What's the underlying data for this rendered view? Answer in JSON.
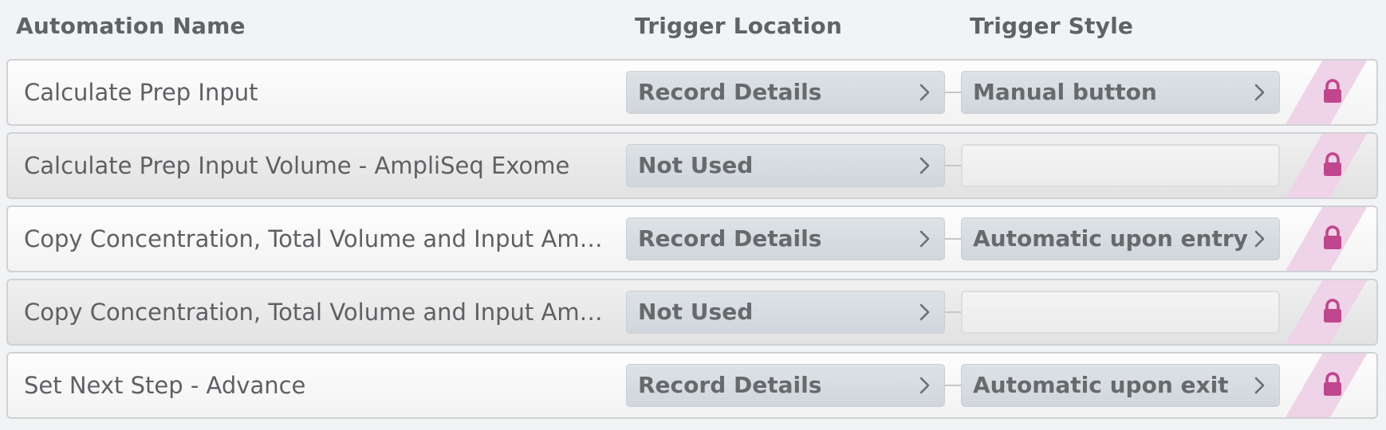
{
  "header": {
    "name_label": "Automation Name",
    "location_label": "Trigger Location",
    "style_label": "Trigger Style"
  },
  "colors": {
    "lock": "#c0468e",
    "lock_stripe": "#efd3e8",
    "pill_fill": "#d5dbe0",
    "text": "#5e6064"
  },
  "icons": {
    "chevron": "chevron-right-icon",
    "lock": "lock-icon"
  },
  "automations": [
    {
      "name": "Calculate Prep Input",
      "trigger_location": "Record Details",
      "trigger_style": "Manual button",
      "locked": true
    },
    {
      "name": "Calculate Prep Input Volume - AmpliSeq Exome",
      "trigger_location": "Not Used",
      "trigger_style": "",
      "locked": true
    },
    {
      "name": "Copy Concentration, Total Volume and Input Amount",
      "trigger_location": "Record Details",
      "trigger_style": "Automatic upon entry",
      "locked": true
    },
    {
      "name": "Copy Concentration, Total Volume and Input Amount...",
      "trigger_location": "Not Used",
      "trigger_style": "",
      "locked": true
    },
    {
      "name": "Set Next Step - Advance",
      "trigger_location": "Record Details",
      "trigger_style": "Automatic upon exit",
      "locked": true
    }
  ]
}
